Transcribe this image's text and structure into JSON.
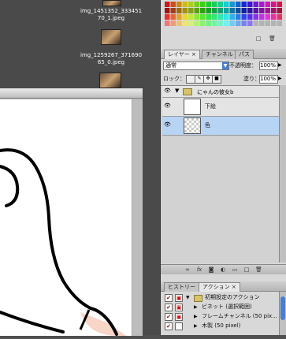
{
  "desktop": {
    "files": [
      {
        "label_line1": "img_1451352_333451",
        "label_line2": "70_1.jpeg"
      },
      {
        "label_line1": "img_1259267_371690",
        "label_line2": "65_0.jpeg"
      }
    ]
  },
  "layers_panel": {
    "tabs": [
      {
        "label": "レイヤー",
        "close": "×"
      },
      {
        "label": "チャンネル"
      },
      {
        "label": "パス"
      }
    ],
    "blend_mode": "通常",
    "opacity_label": "不透明度：",
    "opacity_value": "100%",
    "lock_label": "ロック：",
    "fill_label": "塗り：",
    "fill_value": "100%",
    "group_name": "にゃんの彼女b",
    "layers": [
      {
        "name": "下絵"
      },
      {
        "name": "色"
      }
    ]
  },
  "actions_panel": {
    "tabs": [
      {
        "label": "ヒストリー"
      },
      {
        "label": "アクション",
        "close": "×"
      }
    ],
    "set_name": "初期設定のアクション",
    "actions": [
      {
        "name": "ビネット (選択範囲)"
      },
      {
        "name": "フレームチャンネル (50 pix..."
      },
      {
        "name": "木製 (50 pixel)"
      }
    ]
  },
  "colors": {
    "selection": "#b8d4f4",
    "panel_bg": "#d8d8d8",
    "desktop_bg": "#4a4a4a"
  }
}
